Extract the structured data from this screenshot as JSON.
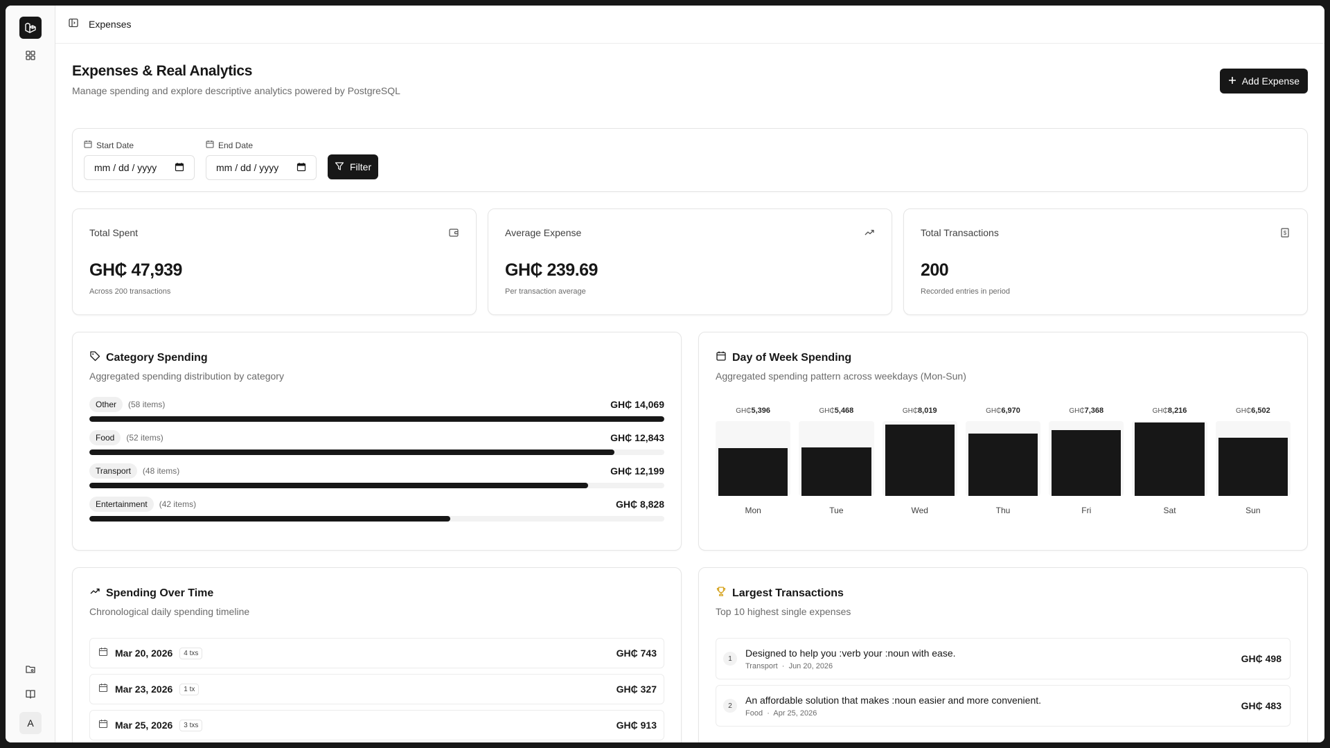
{
  "breadcrumb": "Expenses",
  "header": {
    "title": "Expenses & Real Analytics",
    "subtitle": "Manage spending and explore descriptive analytics powered by PostgreSQL",
    "add_button": "Add Expense"
  },
  "filter": {
    "start_label": "Start Date",
    "start_placeholder": "mm / dd / yyyy",
    "end_label": "End Date",
    "end_placeholder": "mm / dd / yyyy",
    "button": "Filter"
  },
  "stats": [
    {
      "label": "Total Spent",
      "value": "GH₵ 47,939",
      "sub": "Across 200 transactions",
      "icon": "wallet-icon"
    },
    {
      "label": "Average Expense",
      "value": "GH₵ 239.69",
      "sub": "Per transaction average",
      "icon": "trending-up-icon"
    },
    {
      "label": "Total Transactions",
      "value": "200",
      "sub": "Recorded entries in period",
      "icon": "receipt-icon"
    }
  ],
  "category": {
    "title": "Category Spending",
    "subtitle": "Aggregated spending distribution by category",
    "items": [
      {
        "name": "Other",
        "count": "(58 items)",
        "amount": "GH₵ 14,069",
        "value": 14069
      },
      {
        "name": "Food",
        "count": "(52 items)",
        "amount": "GH₵ 12,843",
        "value": 12843
      },
      {
        "name": "Transport",
        "count": "(48 items)",
        "amount": "GH₵ 12,199",
        "value": 12199
      },
      {
        "name": "Entertainment",
        "count": "(42 items)",
        "amount": "GH₵ 8,828",
        "value": 8828
      }
    ]
  },
  "dow": {
    "title": "Day of Week Spending",
    "subtitle": "Aggregated spending pattern across weekdays (Mon-Sun)",
    "currency": "GH₵",
    "days": [
      {
        "day": "Mon",
        "label": "5,396",
        "value": 5396
      },
      {
        "day": "Tue",
        "label": "5,468",
        "value": 5468
      },
      {
        "day": "Wed",
        "label": "8,019",
        "value": 8019
      },
      {
        "day": "Thu",
        "label": "6,970",
        "value": 6970
      },
      {
        "day": "Fri",
        "label": "7,368",
        "value": 7368
      },
      {
        "day": "Sat",
        "label": "8,216",
        "value": 8216
      },
      {
        "day": "Sun",
        "label": "6,502",
        "value": 6502
      }
    ]
  },
  "timeline": {
    "title": "Spending Over Time",
    "subtitle": "Chronological daily spending timeline",
    "rows": [
      {
        "date": "Mar 20, 2026",
        "txs": "4 txs",
        "amount": "GH₵ 743"
      },
      {
        "date": "Mar 23, 2026",
        "txs": "1 tx",
        "amount": "GH₵ 327"
      },
      {
        "date": "Mar 25, 2026",
        "txs": "3 txs",
        "amount": "GH₵ 913"
      }
    ]
  },
  "largest": {
    "title": "Largest Transactions",
    "subtitle": "Top 10 highest single expenses",
    "rows": [
      {
        "rank": "1",
        "desc": "Designed to help you :verb your :noun with ease.",
        "category": "Transport",
        "date": "Jun 20, 2026",
        "amount": "GH₵ 498"
      },
      {
        "rank": "2",
        "desc": "An affordable solution that makes :noun easier and more convenient.",
        "category": "Food",
        "date": "Apr 25, 2026",
        "amount": "GH₵ 483"
      }
    ]
  },
  "rail": {
    "avatar": "A"
  },
  "colors": {
    "accent": "#171717",
    "trophy": "#d4a017"
  }
}
